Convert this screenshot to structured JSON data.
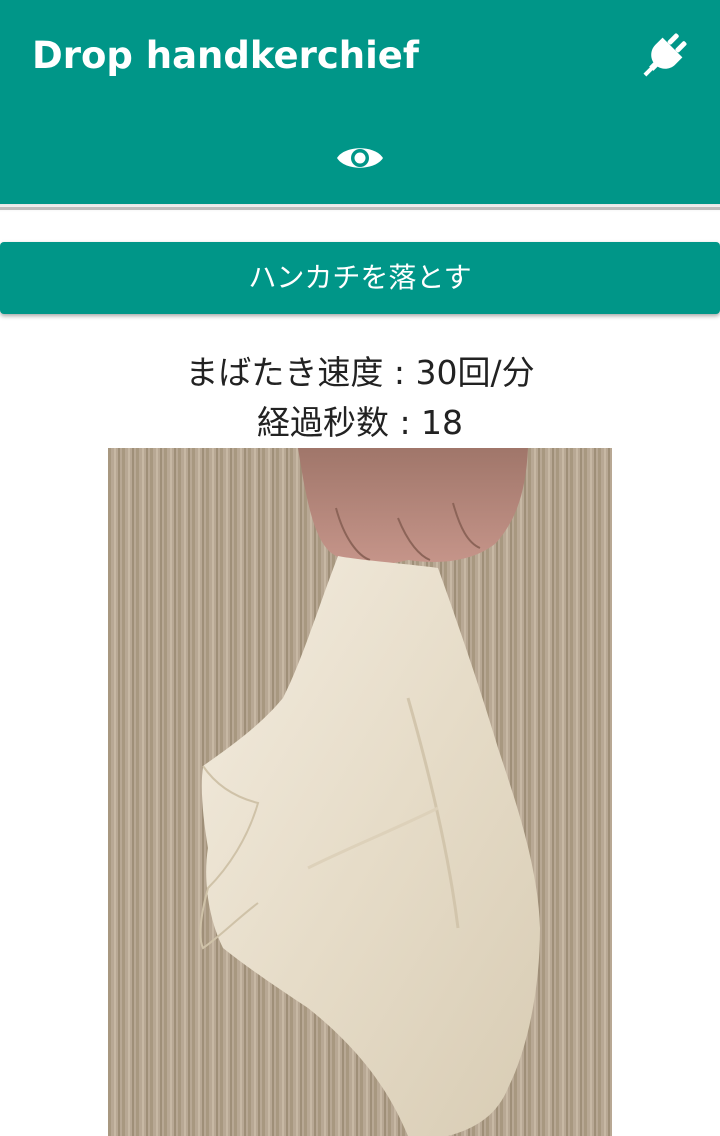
{
  "app_bar": {
    "title": "Drop handkerchief",
    "connect_icon": "power-plug-icon",
    "tab_icon": "eye-icon"
  },
  "actions": {
    "drop_button_label": "ハンカチを落とす"
  },
  "stats": {
    "blink_rate": "まばたき速度 : 30回/分",
    "elapsed_seconds": "経過秒数 : 18"
  },
  "colors": {
    "primary": "#009688",
    "on_primary": "#ffffff",
    "text": "#222222"
  }
}
